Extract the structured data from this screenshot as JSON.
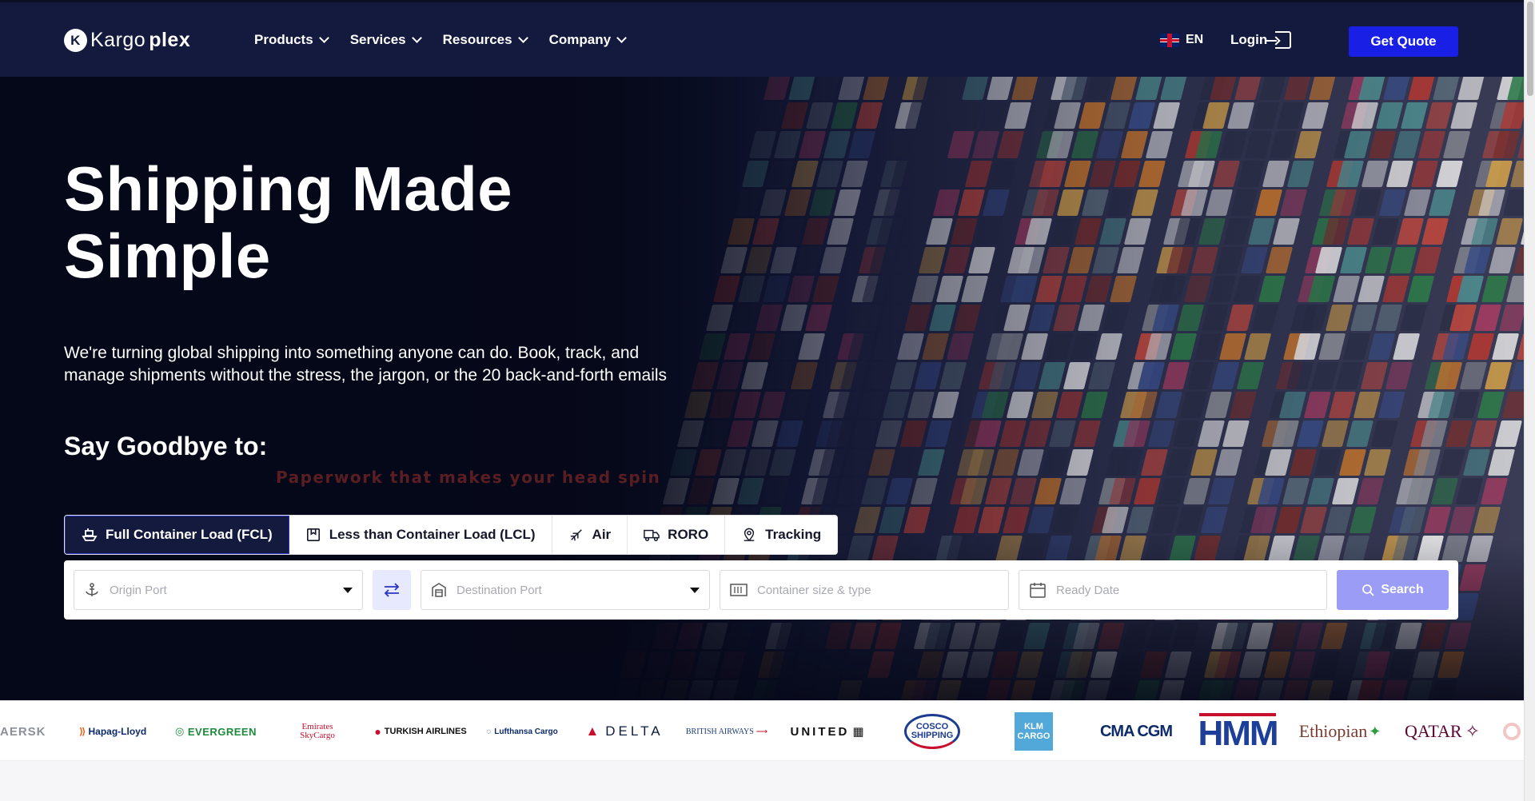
{
  "nav": {
    "logo_prefix": "Kargo",
    "logo_suffix": "plex",
    "menu": [
      "Products",
      "Services",
      "Resources",
      "Company"
    ],
    "language": "EN",
    "login": "Login",
    "cta": "Get Quote"
  },
  "hero": {
    "title_line1": "Shipping Made",
    "title_line2": "Simple",
    "subtitle_line1": "We're turning global shipping into something anyone can do. Book, track, and",
    "subtitle_line2": "manage shipments without the stress, the jargon, or the 20 back-and-forth emails",
    "goodbye": "Say Goodbye to:",
    "rotating_text": "Paperwork that makes your head spin"
  },
  "tabs": [
    {
      "label": "Full Container Load (FCL)",
      "icon": "ship-icon",
      "active": true
    },
    {
      "label": "Less than Container Load (LCL)",
      "icon": "box-icon",
      "active": false
    },
    {
      "label": "Air",
      "icon": "plane-icon",
      "active": false
    },
    {
      "label": "RORO",
      "icon": "truck-icon",
      "active": false
    },
    {
      "label": "Tracking",
      "icon": "location-pin-icon",
      "active": false
    }
  ],
  "search": {
    "origin_placeholder": "Origin Port",
    "destination_placeholder": "Destination Port",
    "container_placeholder": "Container size & type",
    "date_placeholder": "Ready Date",
    "button": "Search"
  },
  "partners": [
    "AERSK",
    "Hapag-Lloyd",
    "EVERGREEN",
    "Emirates SkyCargo",
    "TURKISH AIRLINES",
    "Lufthansa Cargo",
    "DELTA",
    "BRITISH AIRWAYS",
    "UNITED",
    "COSCO SHIPPING",
    "KLM CARGO",
    "CMA CGM",
    "HMM",
    "Ethiopian",
    "QATAR"
  ],
  "colors": {
    "nav_bg": "#141a3d",
    "cta": "#1a1fe6",
    "search_button": "#9a9cf5",
    "swap_bg": "#e7e9ff"
  }
}
